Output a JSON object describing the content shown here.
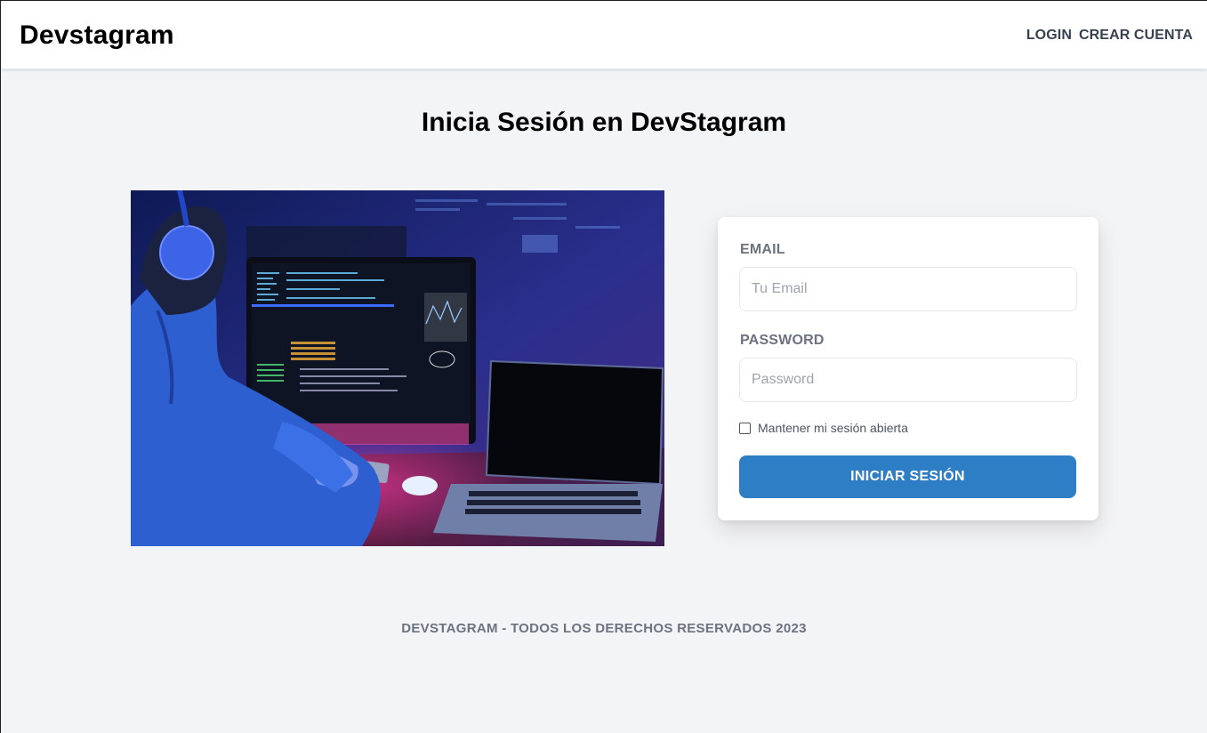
{
  "header": {
    "brand": "Devstagram",
    "nav": [
      {
        "label": "Login"
      },
      {
        "label": "Crear Cuenta"
      }
    ]
  },
  "main": {
    "title": "Inicia Sesión en DevStagram",
    "hero_image": {
      "alt": "Programador frente a computadora"
    },
    "form": {
      "email_label": "Email",
      "email_placeholder": "Tu Email",
      "email_value": "",
      "password_label": "Password",
      "password_placeholder": "Password",
      "password_value": "",
      "remember_label": "Mantener mi sesión abierta",
      "remember_checked": false,
      "submit_label": "Iniciar Sesión"
    }
  },
  "footer": {
    "text": "DevStagram - Todos los derechos reservados 2023"
  },
  "colors": {
    "background": "#f3f4f6",
    "header_bg": "#ffffff",
    "primary_button": "#2e7ec6",
    "label_text": "#6b7280"
  }
}
